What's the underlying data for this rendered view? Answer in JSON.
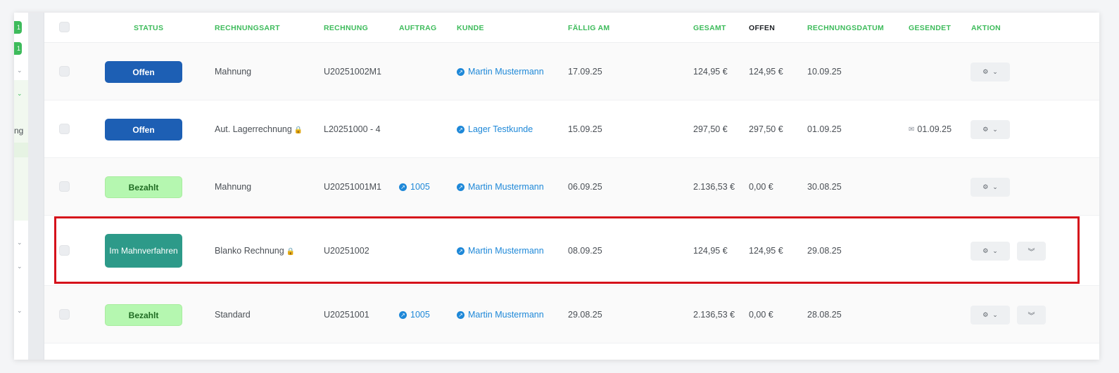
{
  "sidebar": {
    "badges": [
      "1",
      "1"
    ],
    "partial_text": "ng"
  },
  "table": {
    "headers": {
      "status": "STATUS",
      "rechnungsart": "RECHNUNGSART",
      "rechnung": "RECHNUNG",
      "auftrag": "AUFTRAG",
      "kunde": "KUNDE",
      "faellig": "FÄLLIG AM",
      "gesamt": "GESAMT",
      "offen": "OFFEN",
      "rechnungsdatum": "RECHNUNGSDATUM",
      "gesendet": "GESENDET",
      "aktion": "AKTION"
    },
    "rows": [
      {
        "status": "Offen",
        "status_type": "open",
        "art": "Mahnung",
        "locked": false,
        "rechnung": "U20251002M1",
        "auftrag": "",
        "kunde": "Martin Mustermann",
        "faellig": "17.09.25",
        "gesamt": "124,95 €",
        "offen": "124,95 €",
        "datum": "10.09.25",
        "gesendet": ""
      },
      {
        "status": "Offen",
        "status_type": "open",
        "art": "Aut. Lagerrechnung",
        "locked": true,
        "rechnung": "L20251000 - 4",
        "auftrag": "",
        "kunde": "Lager Testkunde",
        "faellig": "15.09.25",
        "gesamt": "297,50 €",
        "offen": "297,50 €",
        "datum": "01.09.25",
        "gesendet": "01.09.25"
      },
      {
        "status": "Bezahlt",
        "status_type": "paid",
        "art": "Mahnung",
        "locked": false,
        "rechnung": "U20251001M1",
        "auftrag": "1005",
        "kunde": "Martin Mustermann",
        "faellig": "06.09.25",
        "gesamt": "2.136,53 €",
        "offen": "0,00 €",
        "datum": "30.08.25",
        "gesendet": ""
      },
      {
        "status": "Im Mahnverfahren",
        "status_type": "dun",
        "art": "Blanko Rechnung",
        "locked": true,
        "rechnung": "U20251002",
        "auftrag": "",
        "kunde": "Martin Mustermann",
        "faellig": "08.09.25",
        "gesamt": "124,95 €",
        "offen": "124,95 €",
        "datum": "29.08.25",
        "gesendet": ""
      },
      {
        "status": "Bezahlt",
        "status_type": "paid",
        "art": "Standard",
        "locked": false,
        "rechnung": "U20251001",
        "auftrag": "1005",
        "kunde": "Martin Mustermann",
        "faellig": "29.08.25",
        "gesamt": "2.136,53 €",
        "offen": "0,00 €",
        "datum": "28.08.25",
        "gesendet": ""
      }
    ]
  },
  "icons": {
    "lock": "lock-icon",
    "link": "external-link-icon",
    "gear": "gear-icon",
    "chevron": "chevron-down-icon",
    "expand": "double-chevron-down-icon",
    "mail": "mail-sent-icon"
  },
  "colors": {
    "header_accent": "#3dbb5b",
    "status_open": "#1d5fb4",
    "status_paid": "#b5f7b0",
    "status_dunning": "#2d9a89",
    "link": "#1e88d8",
    "highlight": "#d5121b"
  }
}
